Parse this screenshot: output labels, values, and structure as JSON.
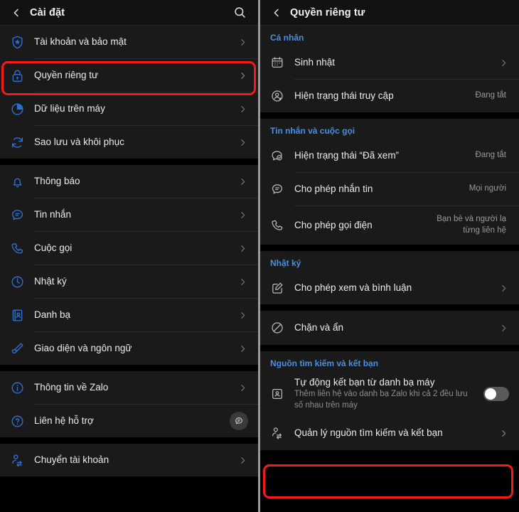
{
  "left_panel": {
    "header": {
      "title": "Cài đặt",
      "back_icon": "chevron-left-icon",
      "search_icon": "search-icon"
    },
    "groups": [
      {
        "items": [
          {
            "icon": "shield-star-icon",
            "label": "Tài khoản và bảo mật",
            "chevron": true
          },
          {
            "icon": "lock-icon",
            "label": "Quyền riêng tư",
            "chevron": true,
            "highlighted": true
          },
          {
            "icon": "pie-chart-icon",
            "label": "Dữ liệu trên máy",
            "chevron": true
          },
          {
            "icon": "sync-icon",
            "label": "Sao lưu và khôi phục",
            "chevron": true
          }
        ]
      },
      {
        "items": [
          {
            "icon": "bell-icon",
            "label": "Thông báo",
            "chevron": true
          },
          {
            "icon": "message-icon",
            "label": "Tin nhắn",
            "chevron": true
          },
          {
            "icon": "phone-icon",
            "label": "Cuộc gọi",
            "chevron": true
          },
          {
            "icon": "clock-icon",
            "label": "Nhật ký",
            "chevron": true
          },
          {
            "icon": "contact-book-icon",
            "label": "Danh bạ",
            "chevron": true
          },
          {
            "icon": "brush-icon",
            "label": "Giao diện và ngôn ngữ",
            "chevron": true
          }
        ]
      },
      {
        "items": [
          {
            "icon": "info-icon",
            "label": "Thông tin về Zalo",
            "chevron": true
          },
          {
            "icon": "question-icon",
            "label": "Liên hệ hỗ trợ",
            "chevron": false,
            "badge": "chat-bubble-icon"
          }
        ]
      },
      {
        "items": [
          {
            "icon": "account-switch-icon",
            "label": "Chuyển tài khoản",
            "chevron": true
          }
        ]
      }
    ]
  },
  "right_panel": {
    "header": {
      "title": "Quyền riêng tư",
      "back_icon": "chevron-left-icon"
    },
    "sections": [
      {
        "title": "Cá nhân",
        "items": [
          {
            "icon": "calendar-icon",
            "label": "Sinh nhật",
            "chevron": true
          },
          {
            "icon": "person-status-icon",
            "label": "Hiện trạng thái truy cập",
            "value": "Đang tắt"
          }
        ]
      },
      {
        "title": "Tin nhắn và cuộc gọi",
        "items": [
          {
            "icon": "message-check-icon",
            "label": "Hiện trạng thái “Đã xem”",
            "value": "Đang tắt"
          },
          {
            "icon": "message-icon",
            "label": "Cho phép nhắn tin",
            "value": "Mọi người"
          },
          {
            "icon": "phone-icon",
            "label": "Cho phép gọi điện",
            "value": "Bạn bè và người lạ từng liên hệ"
          }
        ]
      },
      {
        "title": "Nhật ký",
        "items": [
          {
            "icon": "edit-square-icon",
            "label": "Cho phép xem và bình luận",
            "chevron": true
          }
        ]
      },
      {
        "title": "",
        "items": [
          {
            "icon": "block-icon",
            "label": "Chặn và ẩn",
            "chevron": true
          }
        ]
      },
      {
        "title": "Nguồn tìm kiếm và kết bạn",
        "items": [
          {
            "icon": "contact-card-icon",
            "label": "Tự động kết bạn từ danh bạ máy",
            "sublabel": "Thêm liên hệ vào danh bạ Zalo khi cả 2 đều lưu số nhau trên máy",
            "toggle": "off"
          },
          {
            "icon": "account-switch-icon",
            "label": "Quản lý nguồn tìm kiếm và kết bạn",
            "chevron": true,
            "highlighted": true
          }
        ]
      }
    ]
  },
  "colors": {
    "accent_blue": "#2f6fd0",
    "section_title": "#4a8fe0",
    "highlight_red": "#f51b1b",
    "row_bg": "#1a1a1a",
    "page_bg": "#000000",
    "muted_text": "#9a9a9a"
  }
}
